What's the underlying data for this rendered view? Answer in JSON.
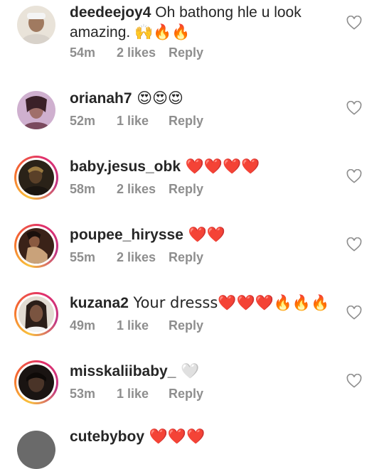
{
  "comments": [
    {
      "username": "deedeejoy4",
      "text_line1": " Oh bathong hle u look",
      "text_line2": "amazing. 🙌🔥🔥",
      "time": "54m",
      "likes": "2 likes",
      "reply": "Reply",
      "ring": false,
      "avatar_colors": [
        "#e8e2d8",
        "#8a6a55",
        "#3d3d3d"
      ]
    },
    {
      "username": "orianah7",
      "text": " 😍😍😍",
      "time": "52m",
      "likes": "1 like",
      "reply": "Reply",
      "ring": false,
      "avatar_colors": [
        "#c9a9c7",
        "#7a4a5e",
        "#2b1a22"
      ]
    },
    {
      "username": "baby.jesus_obk",
      "text": " ❤️❤️❤️❤️",
      "time": "58m",
      "likes": "2 likes",
      "reply": "Reply",
      "ring": true,
      "avatar_colors": [
        "#5a4a30",
        "#2a2015",
        "#1a1510"
      ]
    },
    {
      "username": "poupee_hirysse",
      "text": " ❤️❤️",
      "time": "55m",
      "likes": "2 likes",
      "reply": "Reply",
      "ring": true,
      "avatar_colors": [
        "#8a5a40",
        "#3a2218",
        "#c9a27a"
      ]
    },
    {
      "username": "kuzana2",
      "text": " Your dresss❤️❤️❤️🔥🔥🔥",
      "time": "49m",
      "likes": "1 like",
      "reply": "Reply",
      "ring": true,
      "avatar_colors": [
        "#dcd6cc",
        "#6a4a38",
        "#2a1e18"
      ]
    },
    {
      "username": "misskaliibaby_",
      "text": " 🤍",
      "time": "53m",
      "likes": "1 like",
      "reply": "Reply",
      "ring": true,
      "avatar_colors": [
        "#2a1e1a",
        "#4a3428",
        "#1a1412"
      ]
    },
    {
      "username": "cutebyboy",
      "text": " ❤️❤️❤️",
      "partial": true,
      "ring": false,
      "avatar_colors": [
        "#6a6a6a",
        "#444444",
        "#222222"
      ]
    }
  ],
  "colors": {
    "heart_red": "#e0182d",
    "fire_orange": "#f57d0e",
    "emoji_yellow": "#f5c22a",
    "meta_gray": "#8e8e8e"
  }
}
